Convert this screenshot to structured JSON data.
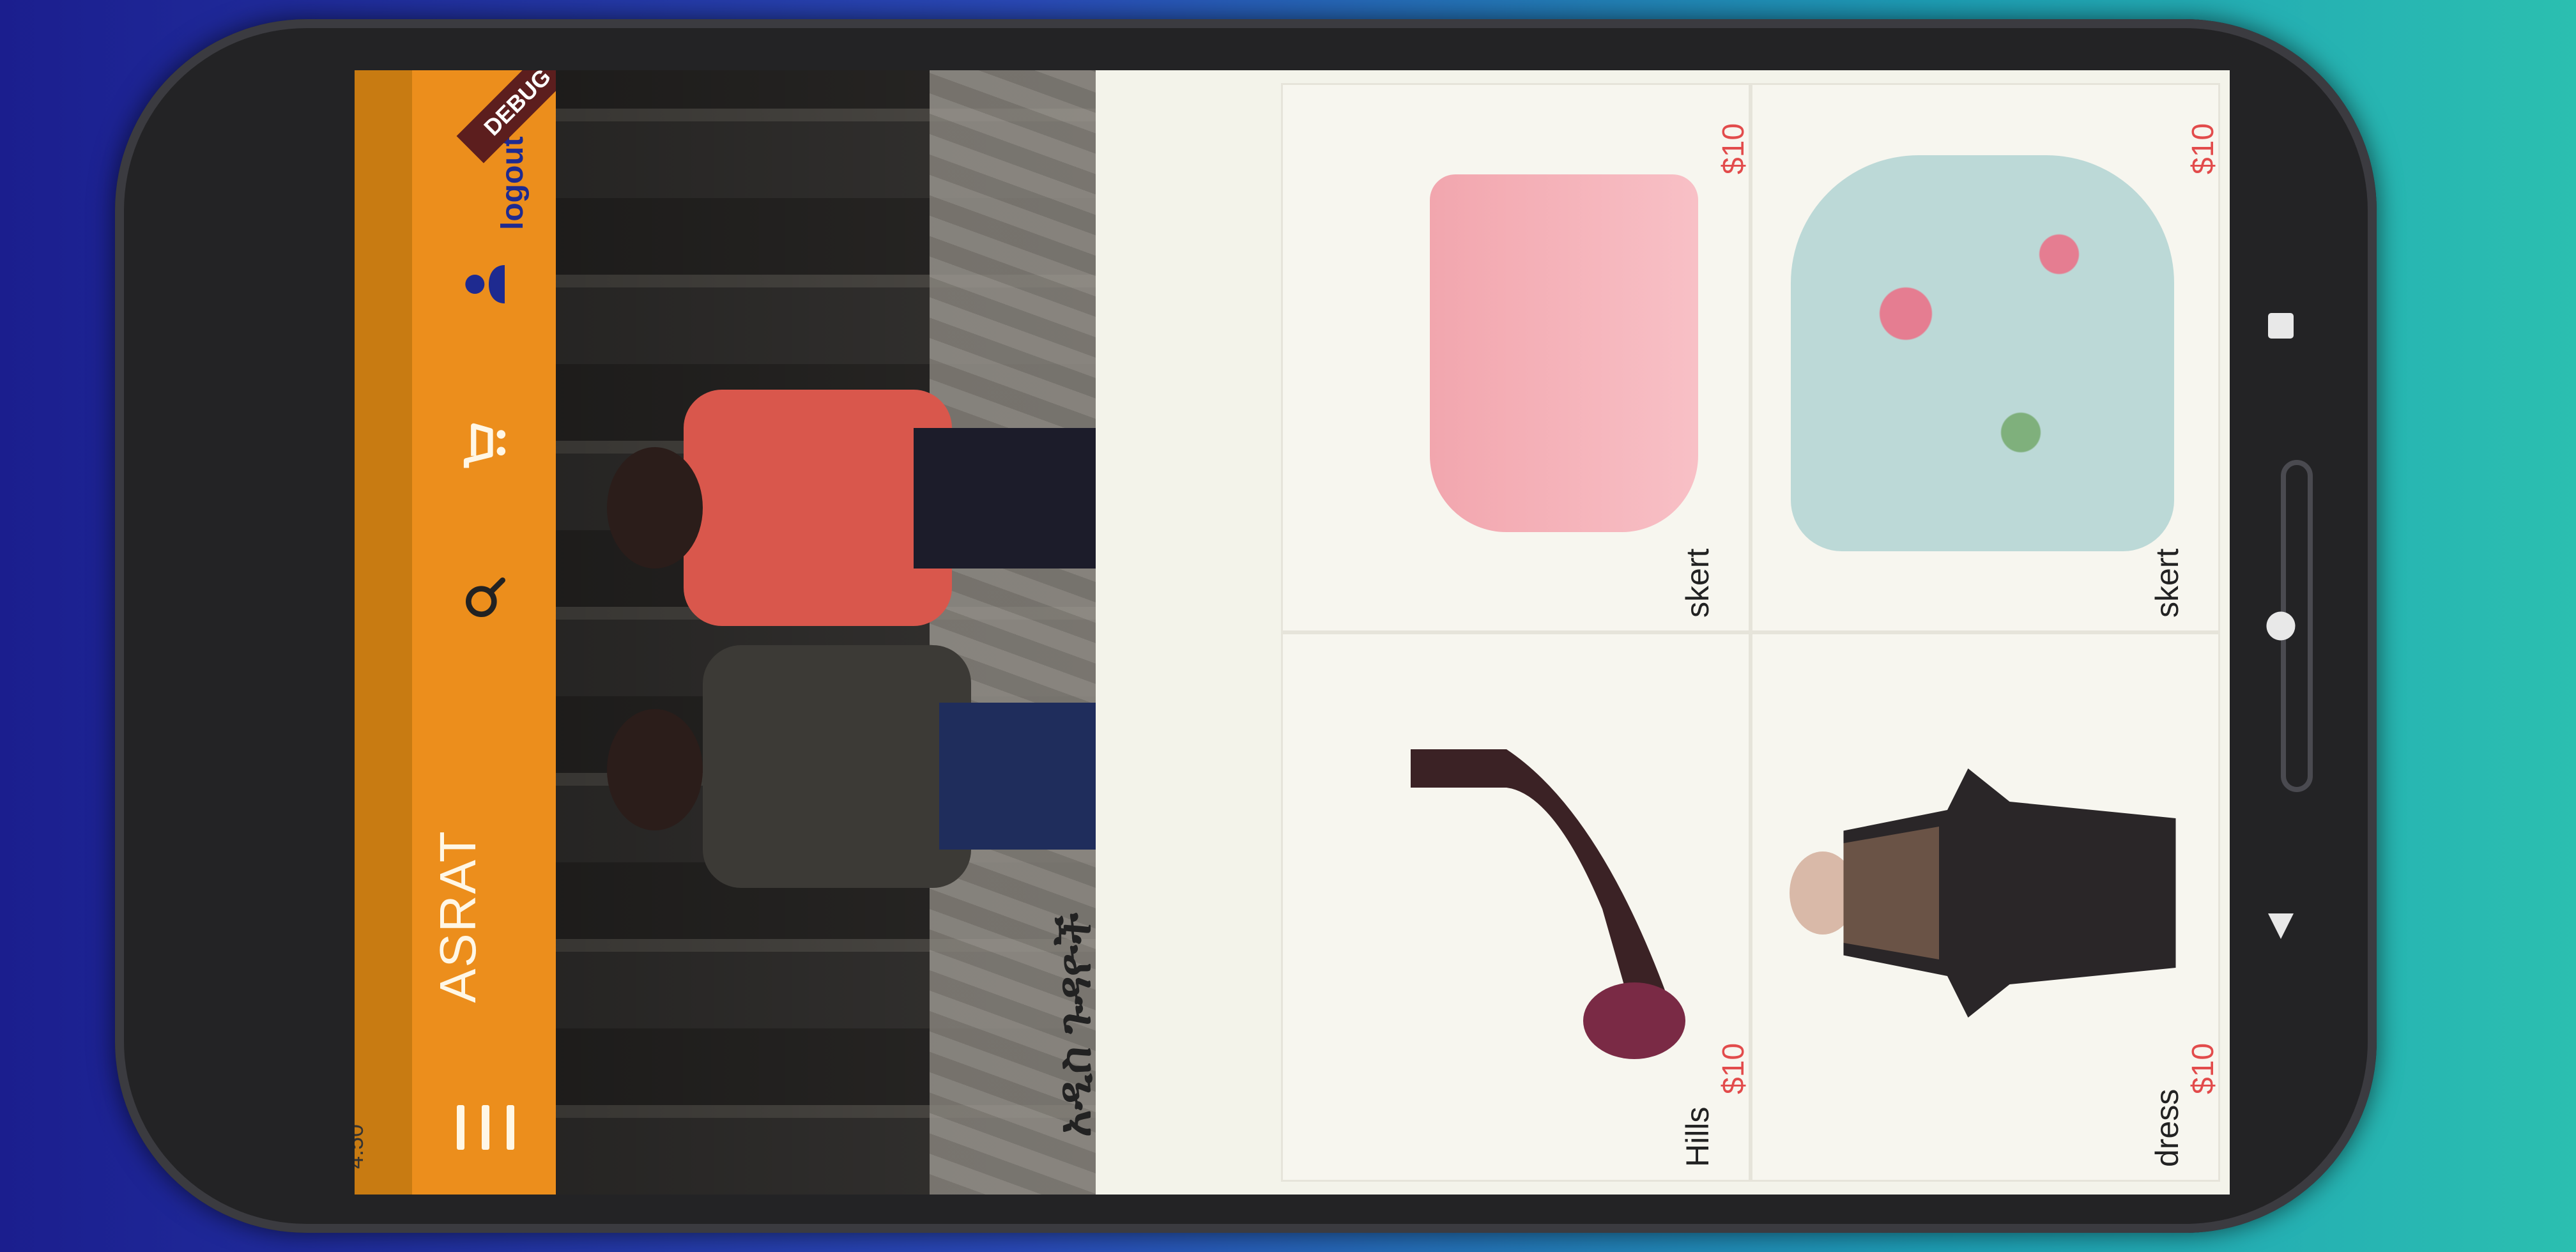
{
  "status_bar": {
    "time": "4:50"
  },
  "app_bar": {
    "title": "ASRAT",
    "logout_label": "logout",
    "debug_banner": "DEBUG",
    "icons": [
      "menu-icon",
      "search-icon",
      "cart-icon",
      "person-icon"
    ],
    "color": "#ec8e1c"
  },
  "section": {
    "title": "አዲስ ጉዳዮች"
  },
  "products": [
    {
      "name": "Hills",
      "price": "$10",
      "image": "high-heel-shoe"
    },
    {
      "name": "skert",
      "price": "$10",
      "image": "pink-skirt"
    },
    {
      "name": "dress",
      "price": "$10",
      "image": "black-dress"
    },
    {
      "name": "skert",
      "price": "$10",
      "image": "floral-dress"
    }
  ],
  "nav_bar": {
    "icons": [
      "back-icon",
      "home-icon",
      "recents-icon"
    ]
  },
  "colors": {
    "accent": "#ec8e1c",
    "price": "#e24b4b",
    "logout": "#1e2a90"
  }
}
